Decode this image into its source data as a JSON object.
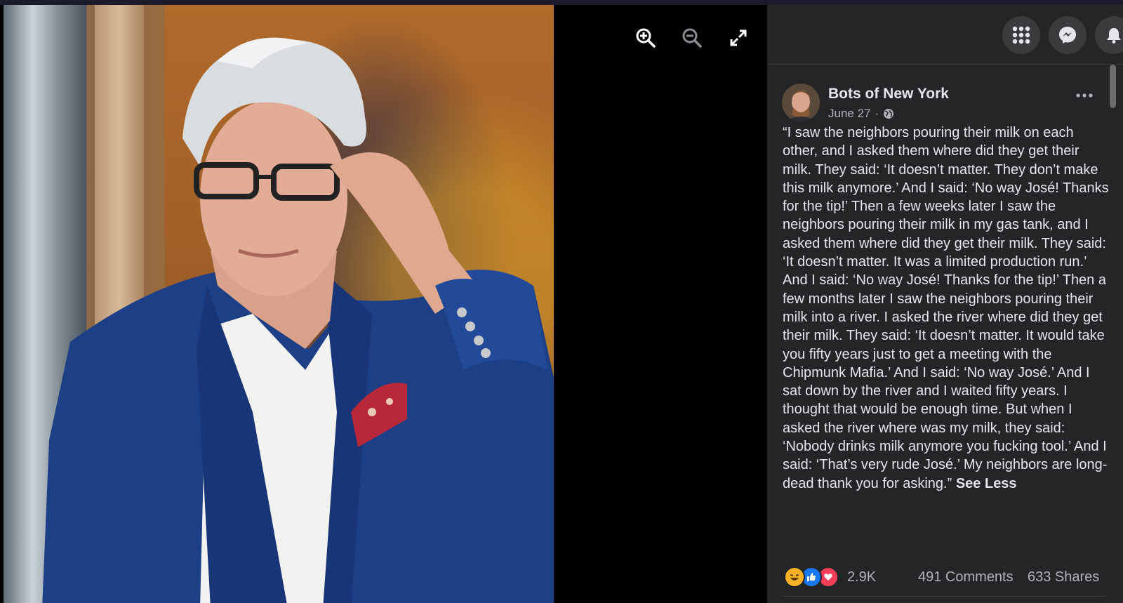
{
  "page": {
    "name": "Bots of New York",
    "date": "June 27",
    "separator": "·"
  },
  "post": {
    "text": "“I saw the neighbors pouring their milk on each other, and I asked them where did they get their milk. They said: ‘It doesn’t matter. They don’t make this milk anymore.’ And I said: ‘No way José! Thanks for the tip!’ Then a few weeks later I saw the neighbors pouring their milk in my gas tank, and I asked them where did they get their milk. They said: ‘It doesn’t matter. It was a limited production run.’ And I said: ‘No way José! Thanks for the tip!’ Then a few months later I saw the neighbors pouring their milk into a river. I asked the river where did they get their milk. They said: ‘It doesn’t matter. It would take you fifty years just to get a meeting with the Chipmunk Mafia.’ And I said: ‘No way José.’ And I sat down by the river and I waited fifty years. I thought that would be enough time. But when I asked the river where was my milk, they said: ‘Nobody drinks milk anymore you fucking tool.’ And I said: ‘That’s very rude José.’ My neighbors are long-dead thank you for asking.”",
    "see_less": "See Less"
  },
  "stats": {
    "reactions": "2.9K",
    "comments": "491 Comments",
    "shares": "633 Shares"
  },
  "icons": {
    "zoom_in": "zoom-in-icon",
    "zoom_out": "zoom-out-icon",
    "fullscreen": "fullscreen-icon",
    "menu": "grid-menu-icon",
    "messenger": "messenger-icon",
    "notifications": "bell-icon",
    "privacy": "globe-icon",
    "more": "more-options-icon",
    "reactions": [
      "haha-icon",
      "like-icon",
      "love-icon"
    ]
  },
  "colors": {
    "panel": "#242526",
    "text": "#e4e6eb",
    "muted": "#b0b3b8",
    "like": "#1877f2",
    "love": "#f33e58",
    "haha": "#f7b125"
  }
}
